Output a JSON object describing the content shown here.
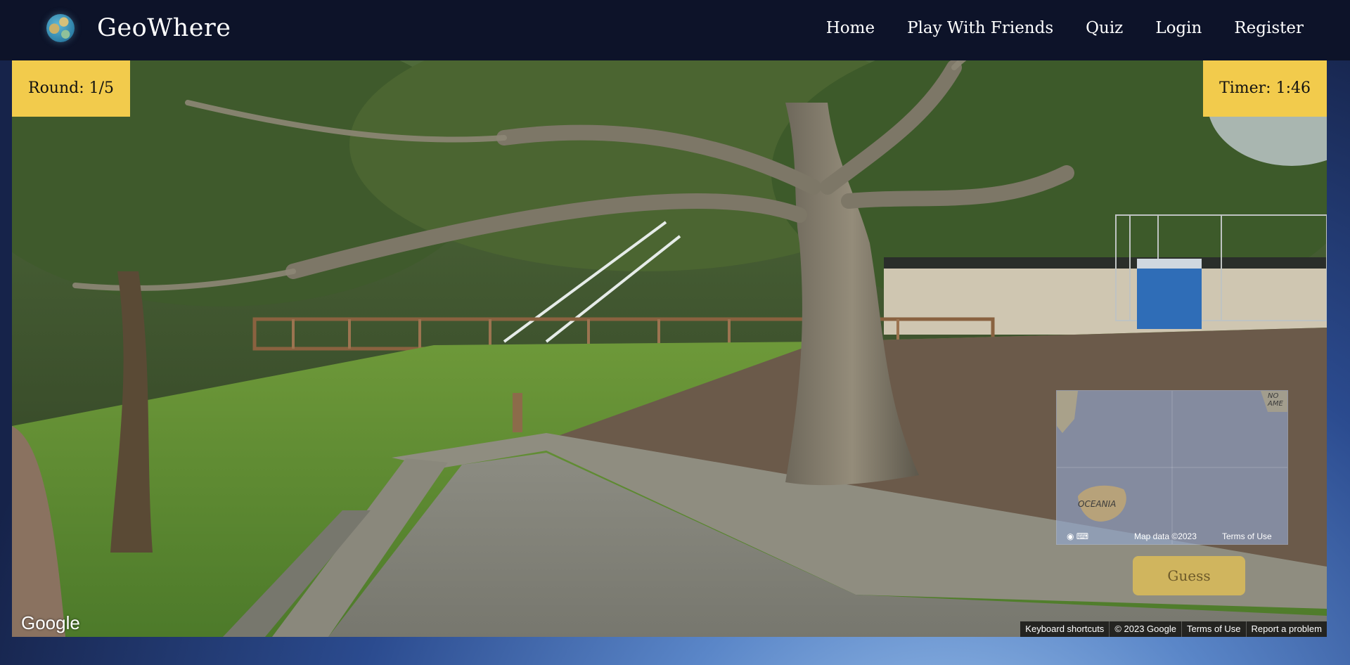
{
  "app": {
    "brand": "GeoWhere",
    "logo_icon": "globe-icon"
  },
  "nav": {
    "items": [
      "Home",
      "Play With Friends",
      "Quiz",
      "Login",
      "Register"
    ]
  },
  "game": {
    "round_label": "Round: 1/5",
    "timer_label": "Timer: 1:46",
    "guess_label": "Guess"
  },
  "minimap": {
    "labels": {
      "oceania": "OCEANIA",
      "north_america": "NO AME"
    },
    "map_data": "Map data ©2023",
    "terms": "Terms of Use"
  },
  "streetview": {
    "google_logo": "Google",
    "footer": [
      "Keyboard shortcuts",
      "© 2023 Google",
      "Terms of Use",
      "Report a problem"
    ]
  },
  "colors": {
    "navbar": "#0d1329",
    "accent": "#f2cb4c"
  }
}
